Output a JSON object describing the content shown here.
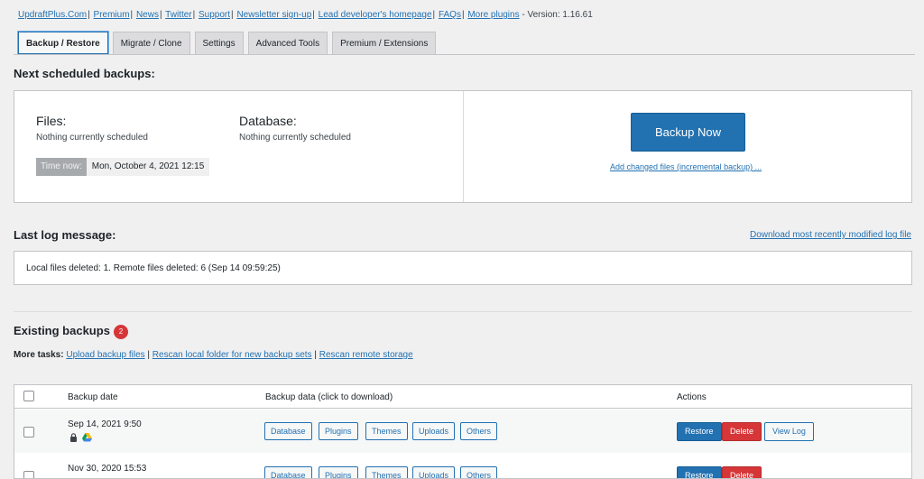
{
  "top_links": [
    "UpdraftPlus.Com",
    "Premium",
    "News",
    "Twitter",
    "Support",
    "Newsletter sign-up",
    "Lead developer's homepage",
    "FAQs",
    "More plugins"
  ],
  "version_text": "- Version: 1.16.61",
  "tabs": [
    "Backup / Restore",
    "Migrate / Clone",
    "Settings",
    "Advanced Tools",
    "Premium / Extensions"
  ],
  "schedule": {
    "heading": "Next scheduled backups:",
    "files_title": "Files:",
    "files_status": "Nothing currently scheduled",
    "db_title": "Database:",
    "db_status": "Nothing currently scheduled",
    "time_label": "Time now:",
    "time_value": "Mon, October 4, 2021 12:15",
    "backup_now": "Backup Now",
    "incremental_link": "Add changed files (incremental backup) ..."
  },
  "log": {
    "heading": "Last log message:",
    "download_link": "Download most recently modified log file",
    "message": "Local files deleted: 1. Remote files deleted: 6 (Sep 14 09:59:25)"
  },
  "existing": {
    "heading": "Existing backups",
    "count": "2",
    "more_tasks_label": "More tasks:",
    "tasks": [
      "Upload backup files",
      "Rescan local folder for new backup sets",
      "Rescan remote storage"
    ]
  },
  "table": {
    "headers": [
      "Backup date",
      "Backup data (click to download)",
      "Actions"
    ],
    "data_buttons": [
      "Database",
      "Plugins",
      "Themes",
      "Uploads",
      "Others"
    ],
    "rows": [
      {
        "date": "Sep 14, 2021 9:50",
        "actions": [
          "Restore",
          "Delete",
          "View Log"
        ]
      },
      {
        "date": "Nov 30, 2020 15:53",
        "actions": [
          "Restore",
          "Delete"
        ]
      }
    ]
  },
  "colors": {
    "accent": "#2271b1",
    "danger": "#d63638"
  }
}
